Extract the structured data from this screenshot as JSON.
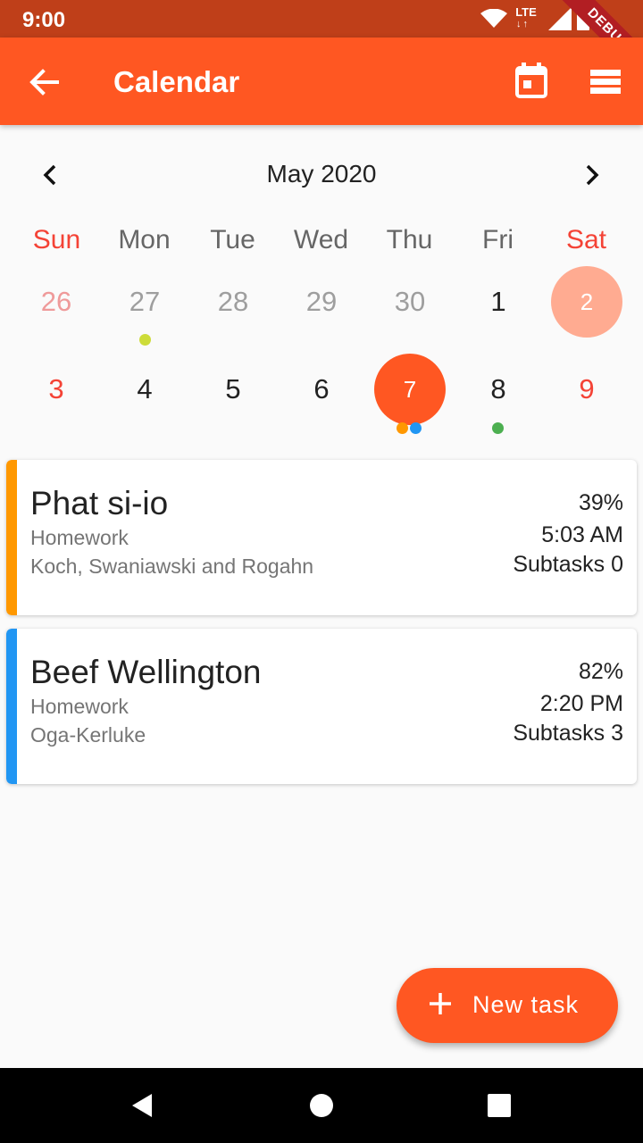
{
  "status_bar": {
    "time": "9:00",
    "network": "LTE"
  },
  "debug_banner": "DEBUG",
  "app_bar": {
    "title": "Calendar"
  },
  "calendar": {
    "month_label": "May 2020",
    "weekdays": [
      "Sun",
      "Mon",
      "Tue",
      "Wed",
      "Thu",
      "Fri",
      "Sat"
    ],
    "week1": [
      "26",
      "27",
      "28",
      "29",
      "30",
      "1",
      "2"
    ],
    "week2": [
      "3",
      "4",
      "5",
      "6",
      "7",
      "8",
      "9"
    ],
    "selected_day": "7",
    "today": "2"
  },
  "tasks": [
    {
      "title": "Phat si-io",
      "category": "Homework",
      "company": "Koch, Swaniawski and Rogahn",
      "percent": "39%",
      "time": "5:03 AM",
      "subtasks": "Subtasks 0",
      "color": "#ff9800"
    },
    {
      "title": "Beef Wellington",
      "category": "Homework",
      "company": "Oga-Kerluke",
      "percent": "82%",
      "time": "2:20 PM",
      "subtasks": "Subtasks 3",
      "color": "#2196f3"
    }
  ],
  "fab": {
    "label": "New task"
  },
  "colors": {
    "primary": "#ff5722",
    "status_bar": "#bf3f19",
    "weekend": "#f44336",
    "dot_lime": "#cddc39",
    "dot_orange": "#ff9800",
    "dot_blue": "#2196f3",
    "dot_green": "#4caf50"
  }
}
